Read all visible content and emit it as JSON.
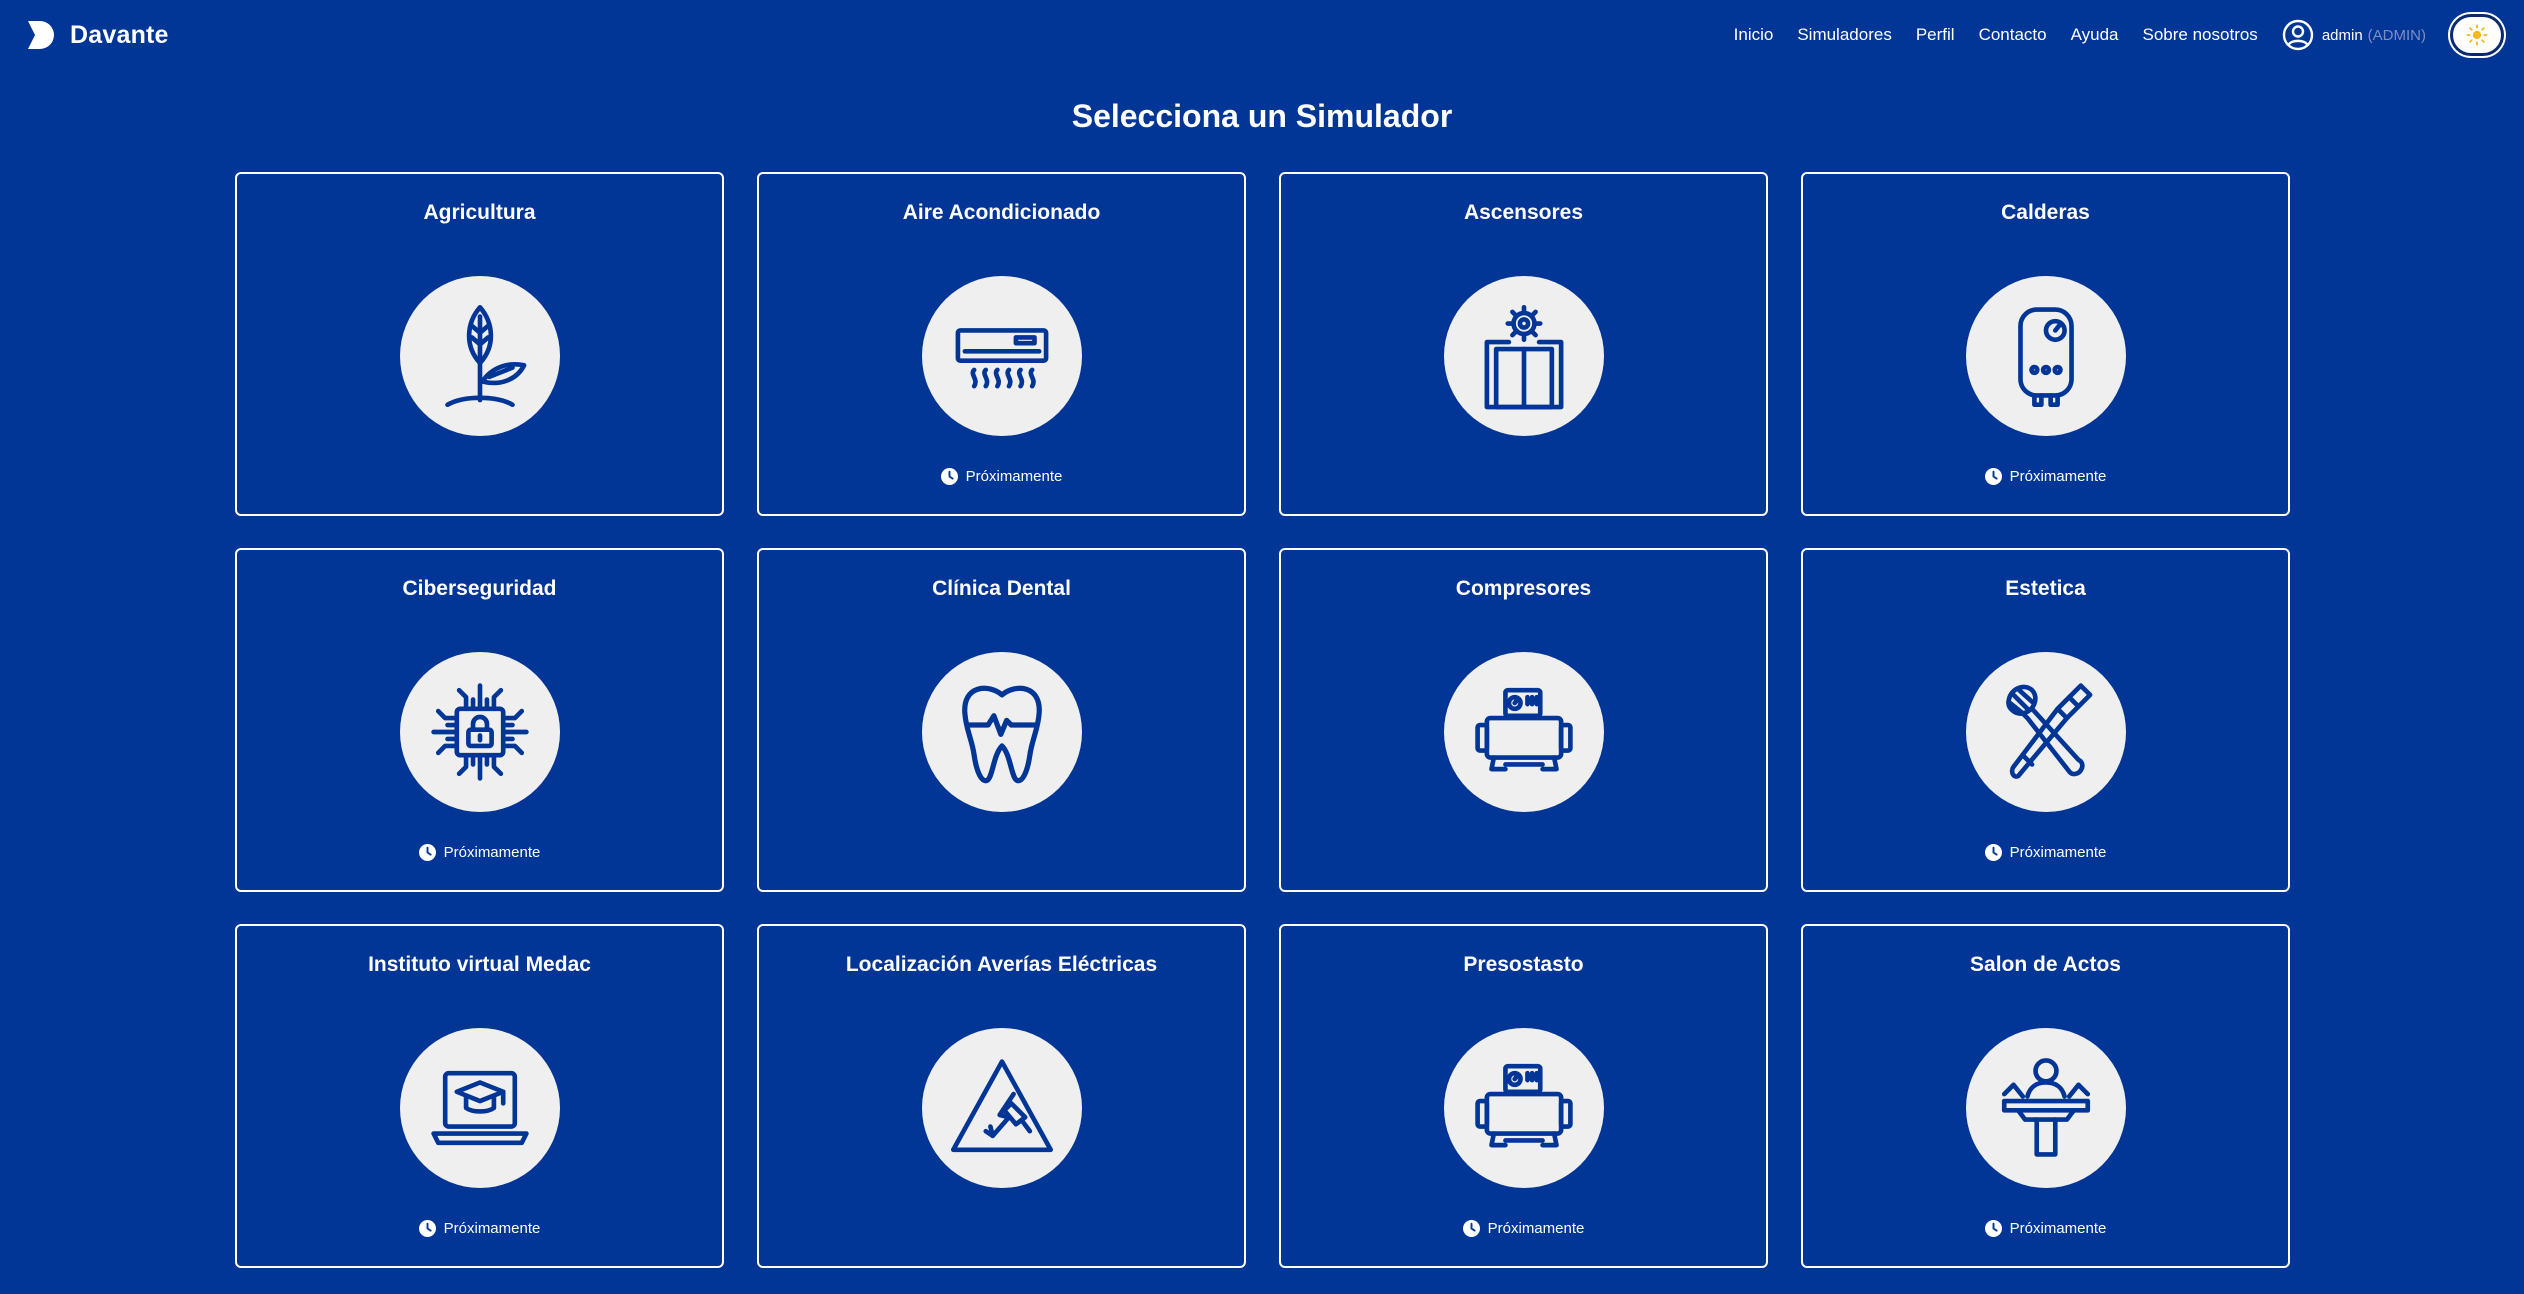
{
  "brand": {
    "name": "Davante",
    "logo_icon": "davante-logo-icon"
  },
  "nav": {
    "links": [
      "Inicio",
      "Simuladores",
      "Perfil",
      "Contacto",
      "Ayuda",
      "Sobre nosotros"
    ],
    "user": {
      "name": "admin",
      "role": "(ADMIN)",
      "icon": "user-circle-icon"
    },
    "theme_toggle_icon": "sun-icon"
  },
  "page": {
    "title": "Selecciona un Simulador"
  },
  "simulators": [
    {
      "title": "Agricultura",
      "icon": "plant-sprout-icon",
      "status": ""
    },
    {
      "title": "Aire Acondicionado",
      "icon": "air-conditioner-icon",
      "status": "Próximamente"
    },
    {
      "title": "Ascensores",
      "icon": "elevator-gear-icon",
      "status": ""
    },
    {
      "title": "Calderas",
      "icon": "boiler-icon",
      "status": "Próximamente"
    },
    {
      "title": "Ciberseguridad",
      "icon": "chip-lock-icon",
      "status": "Próximamente"
    },
    {
      "title": "Clínica Dental",
      "icon": "tooth-icon",
      "status": ""
    },
    {
      "title": "Compresores",
      "icon": "compressor-icon",
      "status": ""
    },
    {
      "title": "Estetica",
      "icon": "makeup-brushes-icon",
      "status": "Próximamente"
    },
    {
      "title": "Instituto virtual Medac",
      "icon": "laptop-graduation-cap-icon",
      "status": "Próximamente"
    },
    {
      "title": "Localización Averías Eléctricas",
      "icon": "electrical-warning-icon",
      "status": ""
    },
    {
      "title": "Presostasto",
      "icon": "pressure-switch-icon",
      "status": "Próximamente"
    },
    {
      "title": "Salon de Actos",
      "icon": "speaker-podium-icon",
      "status": "Próximamente"
    }
  ],
  "colors": {
    "background": "#013596",
    "icon_circle": "#efefef",
    "icon_stroke": "#013596",
    "card_border": "#ffffff"
  }
}
